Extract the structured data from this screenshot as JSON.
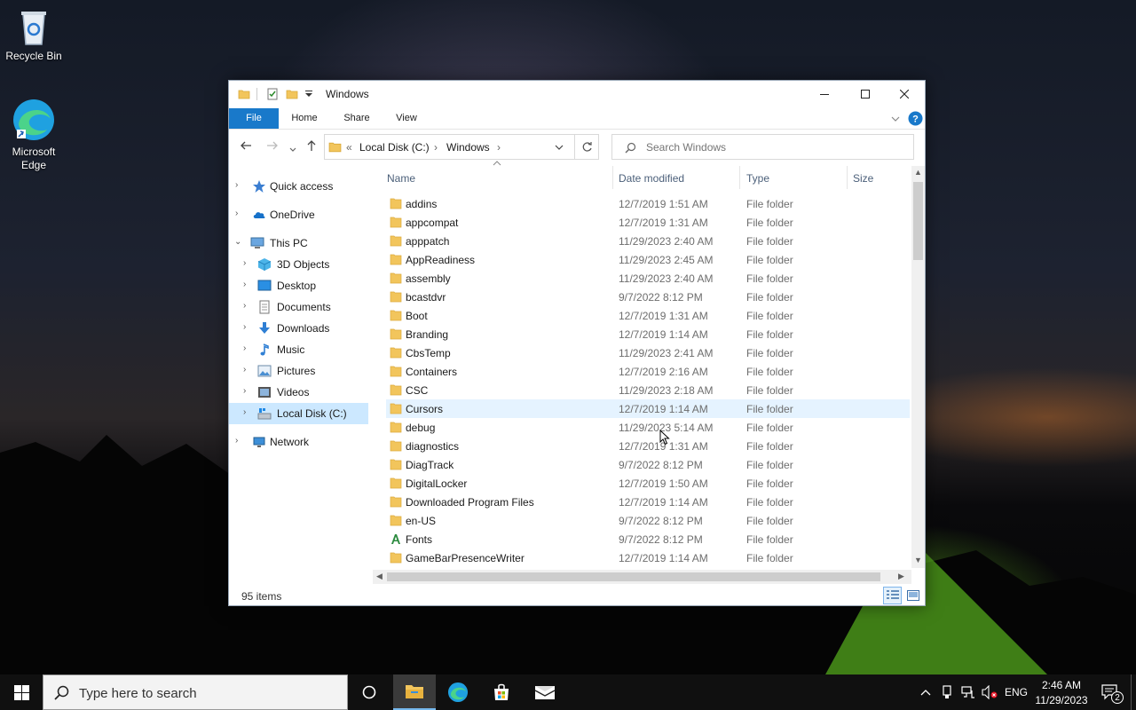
{
  "desktop": {
    "icons": [
      {
        "label": "Recycle Bin"
      },
      {
        "label": "Microsoft Edge"
      }
    ]
  },
  "window": {
    "title": "Windows",
    "ribbon_tabs": [
      "File",
      "Home",
      "Share",
      "View"
    ],
    "address": {
      "overflow": "«",
      "segments": [
        "Local Disk (C:)",
        "Windows"
      ]
    },
    "search_placeholder": "Search Windows",
    "nav_pane": [
      {
        "label": "Quick access",
        "icon": "star-icon",
        "level": 0,
        "expanded": false
      },
      {
        "label": "OneDrive",
        "icon": "cloud-icon",
        "level": 0,
        "expanded": false
      },
      {
        "label": "This PC",
        "icon": "computer-icon",
        "level": 0,
        "expanded": true
      },
      {
        "label": "3D Objects",
        "icon": "cube-icon",
        "level": 1
      },
      {
        "label": "Desktop",
        "icon": "desktop-icon",
        "level": 1
      },
      {
        "label": "Documents",
        "icon": "document-icon",
        "level": 1
      },
      {
        "label": "Downloads",
        "icon": "download-icon",
        "level": 1
      },
      {
        "label": "Music",
        "icon": "music-icon",
        "level": 1
      },
      {
        "label": "Pictures",
        "icon": "picture-icon",
        "level": 1
      },
      {
        "label": "Videos",
        "icon": "video-icon",
        "level": 1
      },
      {
        "label": "Local Disk (C:)",
        "icon": "drive-icon",
        "level": 1,
        "selected": true
      },
      {
        "label": "Network",
        "icon": "network-icon",
        "level": 0,
        "expanded": false
      }
    ],
    "columns": [
      "Name",
      "Date modified",
      "Type",
      "Size"
    ],
    "files": [
      {
        "name": "addins",
        "date": "12/7/2019 1:51 AM",
        "type": "File folder"
      },
      {
        "name": "appcompat",
        "date": "12/7/2019 1:31 AM",
        "type": "File folder"
      },
      {
        "name": "apppatch",
        "date": "11/29/2023 2:40 AM",
        "type": "File folder"
      },
      {
        "name": "AppReadiness",
        "date": "11/29/2023 2:45 AM",
        "type": "File folder"
      },
      {
        "name": "assembly",
        "date": "11/29/2023 2:40 AM",
        "type": "File folder"
      },
      {
        "name": "bcastdvr",
        "date": "9/7/2022 8:12 PM",
        "type": "File folder"
      },
      {
        "name": "Boot",
        "date": "12/7/2019 1:31 AM",
        "type": "File folder"
      },
      {
        "name": "Branding",
        "date": "12/7/2019 1:14 AM",
        "type": "File folder"
      },
      {
        "name": "CbsTemp",
        "date": "11/29/2023 2:41 AM",
        "type": "File folder"
      },
      {
        "name": "Containers",
        "date": "12/7/2019 2:16 AM",
        "type": "File folder"
      },
      {
        "name": "CSC",
        "date": "11/29/2023 2:18 AM",
        "type": "File folder"
      },
      {
        "name": "Cursors",
        "date": "12/7/2019 1:14 AM",
        "type": "File folder",
        "hover": true
      },
      {
        "name": "debug",
        "date": "11/29/2023 5:14 AM",
        "type": "File folder"
      },
      {
        "name": "diagnostics",
        "date": "12/7/2019 1:31 AM",
        "type": "File folder"
      },
      {
        "name": "DiagTrack",
        "date": "9/7/2022 8:12 PM",
        "type": "File folder"
      },
      {
        "name": "DigitalLocker",
        "date": "12/7/2019 1:50 AM",
        "type": "File folder"
      },
      {
        "name": "Downloaded Program Files",
        "date": "12/7/2019 1:14 AM",
        "type": "File folder"
      },
      {
        "name": "en-US",
        "date": "9/7/2022 8:12 PM",
        "type": "File folder"
      },
      {
        "name": "Fonts",
        "date": "9/7/2022 8:12 PM",
        "type": "File folder",
        "icon": "fonts-folder-icon"
      },
      {
        "name": "GameBarPresenceWriter",
        "date": "12/7/2019 1:14 AM",
        "type": "File folder"
      }
    ],
    "status": "95 items"
  },
  "taskbar": {
    "search_placeholder": "Type here to search",
    "language": "ENG",
    "time": "2:46 AM",
    "date": "11/29/2023",
    "notification_count": "2"
  },
  "colors": {
    "accent": "#1979ca",
    "selected": "#cce8ff",
    "hover": "#e5f3ff",
    "folder": "#f2c55c"
  }
}
